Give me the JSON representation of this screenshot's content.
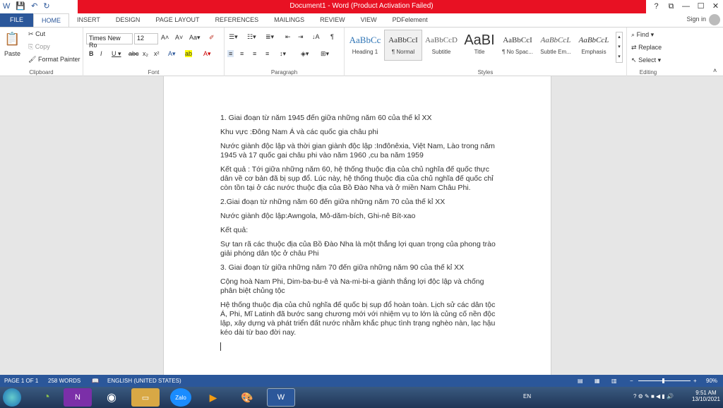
{
  "window": {
    "title": "Document1 - Word (Product Activation Failed)",
    "help": "?",
    "restore_ribbon": "⧉",
    "minimize": "—",
    "maximize": "☐",
    "close": "✕"
  },
  "tabs": [
    "FILE",
    "HOME",
    "INSERT",
    "DESIGN",
    "PAGE LAYOUT",
    "REFERENCES",
    "MAILINGS",
    "REVIEW",
    "VIEW",
    "PDFelement"
  ],
  "sign_in": "Sign in",
  "clipboard": {
    "paste": "Paste",
    "cut": "Cut",
    "copy": "Copy",
    "format_painter": "Format Painter",
    "label": "Clipboard"
  },
  "font": {
    "name": "Times New Ro",
    "size": "12",
    "label": "Font"
  },
  "paragraph": {
    "label": "Paragraph"
  },
  "styles": {
    "label": "Styles",
    "items": [
      {
        "preview": "AaBbCc",
        "name": "Heading 1"
      },
      {
        "preview": "AaBbCcI",
        "name": "¶ Normal"
      },
      {
        "preview": "AaBbCcD",
        "name": "Subtitle"
      },
      {
        "preview": "AaBI",
        "name": "Title"
      },
      {
        "preview": "AaBbCcI",
        "name": "¶ No Spac..."
      },
      {
        "preview": "AaBbCcL",
        "name": "Subtle Em..."
      },
      {
        "preview": "AaBbCcL",
        "name": "Emphasis"
      }
    ]
  },
  "editing": {
    "find": "Find",
    "replace": "Replace",
    "select": "Select",
    "label": "Editing"
  },
  "document": {
    "paragraphs": [
      "1. Giai đoạn từ năm 1945 đến giữa những năm 60 của thế kỉ XX",
      "Khu vực :Đông Nam Á và các quốc gia châu phi",
      "Nước giành độc lập và thời gian giành độc lập :Inđônêxia, Việt Nam, Lào trong năm 1945  và 17 quốc gai châu phi vào năm 1960 ,cu ba năm 1959",
      "Kết quả : Tới giữa những năm 60, hệ thống thuộc địa của chủ nghĩa đế quốc thực dân về cơ bản đã bị sụp đổ. Lúc này, hệ thống thuộc địa của chủ nghĩa đế quốc chỉ còn tồn tại ở các nước thuộc địa của Bồ Đào Nha và ở miền Nam Châu Phi.",
      "2.Giai đoạn từ những năm 60 đến giữa những năm 70 của thế kỉ XX",
      "Nước giành độc lập:Awngola, Mô-dăm-bích, Ghi-nê Bít-xao",
      "Kết quả:",
      " Sự tan rã các thuộc địa của Bồ Đào Nha là một thắng lợi quan trọng của phong trào giải phóng dân tộc ở châu Phi",
      "3. Giai đoạn từ giữa những năm 70 đến giữa những năm 90 của thế kỉ XX",
      "Cộng hoà Nam Phi, Dim-ba-bu-ê và Na-mi-bi-a  giành thắng lợi độc lập và chống phân biệt chủng tộc",
      "Hệ thống thuộc địa của chủ nghĩa đế quốc bị sụp đổ hoàn toàn. Lịch sử các dân tộc Á, Phi, Mĩ Latinh đã bước sang chương mới với nhiệm vụ to lớn là củng cố nền độc lập, xây dựng và phát triển đất nước nhằm khắc phục tình trạng nghèo nàn, lạc hậu kéo dài từ bao đời nay."
    ]
  },
  "status": {
    "page": "PAGE 1 OF 1",
    "words": "258 WORDS",
    "language": "ENGLISH (UNITED STATES)",
    "zoom": "90%"
  },
  "taskbar": {
    "lang": "EN",
    "time": "9:51 AM",
    "date": "13/10/2021",
    "apps": [
      "N",
      "Zalo",
      "W"
    ]
  }
}
